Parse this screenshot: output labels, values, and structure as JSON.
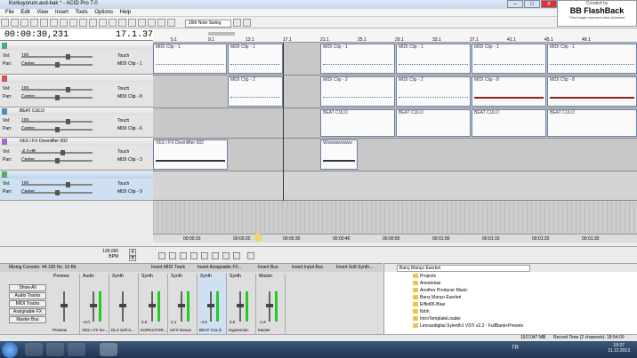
{
  "window": {
    "title": "Korkuyorum.acd-bak * - ACID Pro 7.0",
    "min": "–",
    "max": "□",
    "close": "✕"
  },
  "menu": [
    "File",
    "Edit",
    "View",
    "Insert",
    "Tools",
    "Options",
    "Help"
  ],
  "toolbar": {
    "swing": "16th Note Swing"
  },
  "badge": {
    "created": "Created by",
    "name": "BB FlashBack",
    "note": "This image removed when licensed"
  },
  "time": {
    "position": "00:00:30,231",
    "measure": "17.1.378"
  },
  "tracks": [
    {
      "name": "",
      "vol_label": "Vol:",
      "vol": "100",
      "pan_label": "Pan:",
      "pan": "Center",
      "mode": "Touch",
      "clip": "MIDI Clip - 1"
    },
    {
      "name": "",
      "vol_label": "Vol:",
      "vol": "100",
      "pan_label": "Pan:",
      "pan": "Center",
      "mode": "Touch",
      "clip": "MIDI Clip - 8"
    },
    {
      "name": "BEAT CULO",
      "vol_label": "Vol:",
      "vol": "100",
      "pan_label": "Pan:",
      "pan": "Center",
      "mode": "Touch",
      "clip": "MIDI Clip - 6"
    },
    {
      "name": "VES I FX Downlifter 002",
      "vol_label": "Vol:",
      "vol": "-6,0 dB",
      "pan_label": "Pan:",
      "pan": "Center",
      "mode": "Touch",
      "clip": "MIDI Clip - 3"
    },
    {
      "name": "",
      "vol_label": "Vol:",
      "vol": "100",
      "pan_label": "Pan:",
      "pan": "Center",
      "mode": "Touch",
      "clip": "MIDI Clip - 9"
    }
  ],
  "ruler": [
    "5.1",
    "9.1",
    "13.1",
    "17.1",
    "21.1",
    "25.1",
    "29.1",
    "33.1",
    "37.1",
    "41.1",
    "45.1",
    "49.1"
  ],
  "clips": {
    "midi1": "MIDI Clip - 1",
    "midi2": "MIDI Clip - 2",
    "midi8": "MIDI Clip - 8",
    "beat": "BEAT CULO",
    "down": "VES I FX Downlifter 002",
    "down2": "Wowwwwwww"
  },
  "timeline": [
    "00:00:10",
    "00:00:20",
    "00:00:30",
    "00:00:40",
    "00:00:50",
    "00:01:00",
    "00:01:10",
    "00:01:20",
    "00:01:30"
  ],
  "transport": {
    "bpm": "128,000",
    "bpm_label": "BPM",
    "beats": "4",
    "beats2": "4"
  },
  "mixer": {
    "title": "Mixing Console: 44.100 Hz; 16 Bit",
    "actions": [
      "Insert MIDI Track",
      "Insert Assignable FX...",
      "Insert Bus",
      "Insert Input Bus",
      "Insert Soft Synth..."
    ],
    "side": [
      "Show All",
      "Audio Tracks",
      "MIDI Tracks",
      "Assignable FX",
      "Master Bus"
    ],
    "strips": [
      {
        "name": "Preview",
        "db": "",
        "bottom": "Preview"
      },
      {
        "name": "Audio",
        "db": "-6.0",
        "bottom": "VES I FX Do..."
      },
      {
        "name": "Synth",
        "db": "",
        "bottom": "DLS Soft S..."
      },
      {
        "name": "Synth",
        "db": "0.0",
        "bottom": "KORKUYOR..."
      },
      {
        "name": "Synth",
        "db": "2.1",
        "bottom": "reFX Nexus"
      },
      {
        "name": "Synth",
        "db": "-4.9",
        "bottom": "BEAT CULO"
      },
      {
        "name": "Synth",
        "db": "0.0",
        "bottom": "Hypersonic"
      },
      {
        "name": "Master",
        "db": "-1.8",
        "bottom": "Master"
      }
    ]
  },
  "explorer": {
    "path": "Barış Manço Eserleri",
    "items": [
      "Projects",
      "Anestetasi",
      "Another Producer Music",
      "Barış Manço Eserleri",
      "Eiffel65-Blue",
      "flshh",
      "IntroTemplateLouder",
      "Lennardigital Sylenth1 VSTi v2.2 - FullBank+Presets"
    ]
  },
  "status": {
    "mem": "15/2.047 MB",
    "rec": "Record Time (2 channels): 18:54:00"
  },
  "taskbar": {
    "lang": "TR",
    "time": "19:37",
    "date": "11.12.2013"
  }
}
